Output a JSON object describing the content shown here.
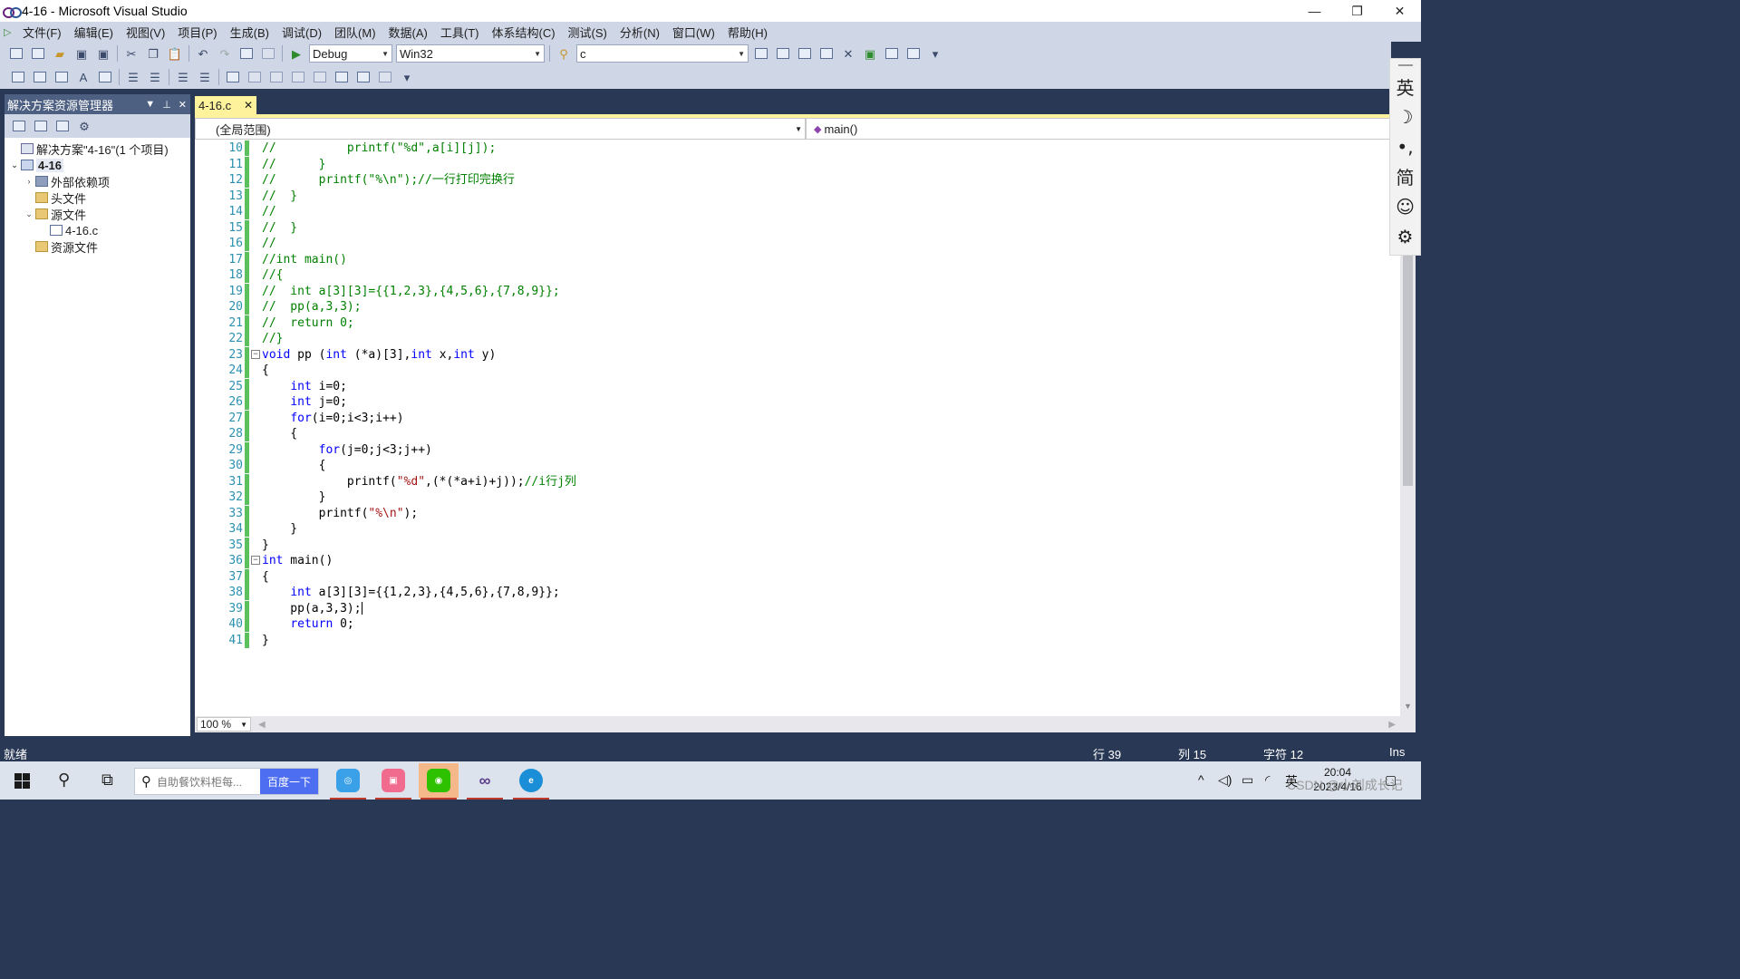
{
  "window": {
    "title": "4-16 - Microsoft Visual Studio",
    "buttons": [
      "—",
      "❐",
      "✕"
    ]
  },
  "menu": [
    "文件(F)",
    "编辑(E)",
    "视图(V)",
    "项目(P)",
    "生成(B)",
    "调试(D)",
    "团队(M)",
    "数据(A)",
    "工具(T)",
    "体系结构(C)",
    "测试(S)",
    "分析(N)",
    "窗口(W)",
    "帮助(H)"
  ],
  "toolbar": {
    "config": "Debug",
    "platform": "Win32",
    "find_value": "c"
  },
  "solution_explorer": {
    "title": "解决方案资源管理器",
    "pin_glyphs": [
      "▼",
      "📌",
      "✕"
    ],
    "items": [
      {
        "label": "解决方案\"4-16\"(1 个项目)",
        "icon": "solution-icon",
        "depth": 0,
        "expander": ""
      },
      {
        "label": "4-16",
        "icon": "project-icon",
        "depth": 0,
        "expander": "⌄",
        "bold": true
      },
      {
        "label": "外部依赖项",
        "icon": "references-icon",
        "depth": 1,
        "expander": "›"
      },
      {
        "label": "头文件",
        "icon": "folder-icon",
        "depth": 1,
        "expander": ""
      },
      {
        "label": "源文件",
        "icon": "folder-icon",
        "depth": 1,
        "expander": "⌄"
      },
      {
        "label": "4-16.c",
        "icon": "c-file-icon",
        "depth": 2,
        "expander": ""
      },
      {
        "label": "资源文件",
        "icon": "folder-icon",
        "depth": 1,
        "expander": ""
      }
    ]
  },
  "document_tab": {
    "name": "4-16.c",
    "close": "✕"
  },
  "navbar": {
    "scope": "(全局范围)",
    "member": "main()"
  },
  "code_lines": [
    {
      "n": "10",
      "html": "<span class=\"c\">//          printf(\"%d\",a[i][j]);</span>"
    },
    {
      "n": "11",
      "html": "<span class=\"c\">//      }</span>"
    },
    {
      "n": "12",
      "html": "<span class=\"c\">//      printf(\"%\\n\");//一行打印完换行</span>"
    },
    {
      "n": "13",
      "html": "<span class=\"c\">//  }</span>"
    },
    {
      "n": "14",
      "html": "<span class=\"c\">//</span>"
    },
    {
      "n": "15",
      "html": "<span class=\"c\">//  }</span>"
    },
    {
      "n": "16",
      "html": "<span class=\"c\">//</span>"
    },
    {
      "n": "17",
      "html": "<span class=\"c\">//int main()</span>"
    },
    {
      "n": "18",
      "html": "<span class=\"c\">//{</span>"
    },
    {
      "n": "19",
      "html": "<span class=\"c\">//  int a[3][3]={{1,2,3},{4,5,6},{7,8,9}};</span>"
    },
    {
      "n": "20",
      "html": "<span class=\"c\">//  pp(a,3,3);</span>"
    },
    {
      "n": "21",
      "html": "<span class=\"c\">//  return 0;</span>"
    },
    {
      "n": "22",
      "html": "<span class=\"c\">//}</span>"
    },
    {
      "n": "23",
      "fold": true,
      "html": "<span class=\"k\">void</span> pp (<span class=\"k\">int</span> (*a)[3],<span class=\"k\">int</span> x,<span class=\"k\">int</span> y)"
    },
    {
      "n": "24",
      "html": "{"
    },
    {
      "n": "25",
      "html": "    <span class=\"k\">int</span> i=0;"
    },
    {
      "n": "26",
      "html": "    <span class=\"k\">int</span> j=0;"
    },
    {
      "n": "27",
      "html": "    <span class=\"k\">for</span>(i=0;i<3;i++)"
    },
    {
      "n": "28",
      "html": "    {"
    },
    {
      "n": "29",
      "html": "        <span class=\"k\">for</span>(j=0;j<3;j++)"
    },
    {
      "n": "30",
      "html": "        {"
    },
    {
      "n": "31",
      "html": "            printf(<span class=\"s\">\"%d\"</span>,(*(*a+i)+j));<span class=\"c\">//i行j列</span>"
    },
    {
      "n": "32",
      "html": "        }"
    },
    {
      "n": "33",
      "html": "        printf(<span class=\"s\">\"%\\n\"</span>);"
    },
    {
      "n": "34",
      "html": "    }"
    },
    {
      "n": "35",
      "html": "}"
    },
    {
      "n": "36",
      "fold": true,
      "html": "<span class=\"k\">int</span> main()"
    },
    {
      "n": "37",
      "html": "{"
    },
    {
      "n": "38",
      "html": "    <span class=\"k\">int</span> a[3][3]={{1,2,3},{4,5,6},{7,8,9}};"
    },
    {
      "n": "39",
      "html": "    pp(a,3,3);<span class=\"caret\"></span>"
    },
    {
      "n": "40",
      "html": "    <span class=\"k\">return</span> 0;"
    },
    {
      "n": "41",
      "html": "}"
    }
  ],
  "zoom": "100 %",
  "ime_bar": [
    "英",
    "☽",
    "•,",
    "简",
    "☺",
    "⚙"
  ],
  "status": {
    "ready": "就绪",
    "row": "行 39",
    "col": "列 15",
    "char": "字符 12",
    "mode": "Ins"
  },
  "taskbar": {
    "search_placeholder": "自助餐饮料柜每...",
    "search_button": "百度一下",
    "tray_lang": "英",
    "time": "20:04",
    "date": "2023/4/16",
    "watermark": "CSDN @小刘成长记"
  },
  "colors": {
    "chrome": "#293955",
    "menu": "#cfd6e5",
    "tab_active": "#fff29d",
    "keyword": "#0000ff",
    "comment": "#008000",
    "string": "#a31515",
    "line_number": "#2b91af",
    "change_bar": "#5cc05c"
  }
}
